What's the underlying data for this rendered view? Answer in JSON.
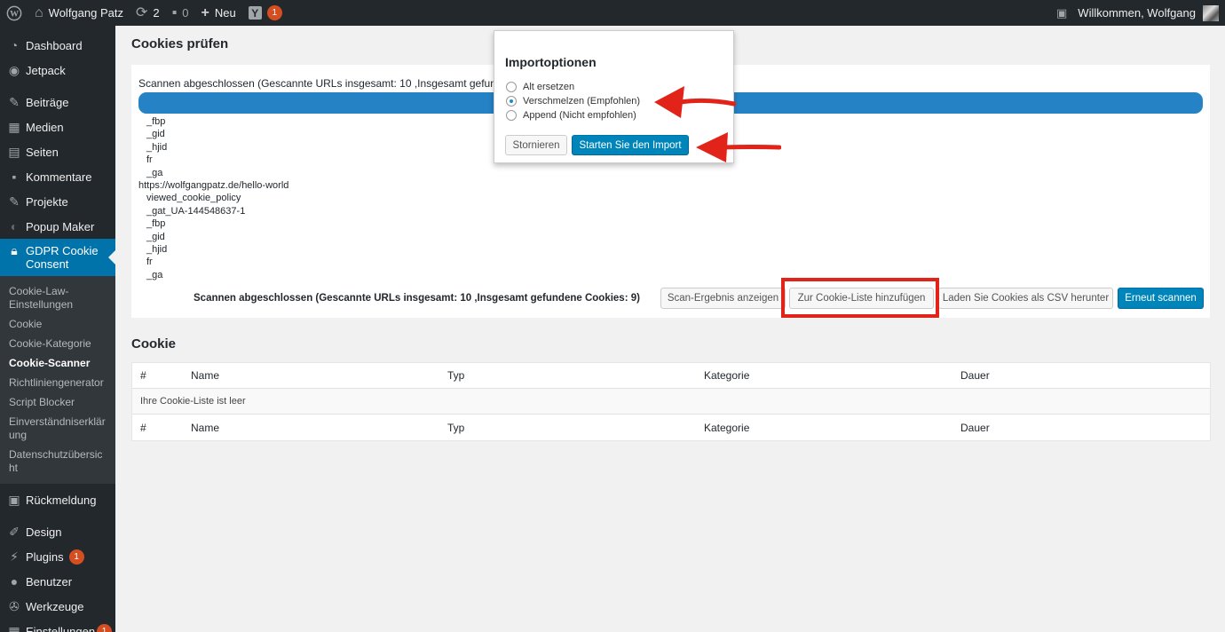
{
  "adminbar": {
    "site_name": "Wolfgang Patz",
    "updates_count": "2",
    "comments_count": "0",
    "new_label": "Neu",
    "yoast_letter": "Y",
    "yoast_badge": "1",
    "greeting": "Willkommen, Wolfgang"
  },
  "sidebar": {
    "dashboard": "Dashboard",
    "jetpack": "Jetpack",
    "beitraege": "Beiträge",
    "medien": "Medien",
    "seiten": "Seiten",
    "kommentare": "Kommentare",
    "projekte": "Projekte",
    "popup_maker": "Popup Maker",
    "gdpr_line1": "GDPR Cookie",
    "gdpr_line2": "Consent",
    "submenu": [
      "Cookie-Law-Einstellungen",
      "Cookie",
      "Cookie-Kategorie",
      "Cookie-Scanner",
      "Richtliniengenerator",
      "Script Blocker",
      "Einverständniserklärung",
      "Datenschutzübersicht"
    ],
    "rueckmeldung": "Rückmeldung",
    "design": "Design",
    "plugins": "Plugins",
    "plugins_badge": "1",
    "benutzer": "Benutzer",
    "werkzeuge": "Werkzeuge",
    "einstellungen": "Einstellungen",
    "einstellungen_badge": "1"
  },
  "main": {
    "page_title": "Cookies prüfen",
    "scan_status": "Scannen abgeschlossen (Gescannte URLs insgesamt: 10 ,Insgesamt gefundene Cookies: 9)",
    "scan_list": [
      {
        "text": "_fbp",
        "type": "cookie"
      },
      {
        "text": "_gid",
        "type": "cookie"
      },
      {
        "text": "_hjid",
        "type": "cookie"
      },
      {
        "text": "fr",
        "type": "cookie"
      },
      {
        "text": "_ga",
        "type": "cookie"
      },
      {
        "text": "https://wolfgangpatz.de/hello-world",
        "type": "url"
      },
      {
        "text": "viewed_cookie_policy",
        "type": "cookie"
      },
      {
        "text": "_gat_UA-144548637-1",
        "type": "cookie"
      },
      {
        "text": "_fbp",
        "type": "cookie"
      },
      {
        "text": "_gid",
        "type": "cookie"
      },
      {
        "text": "_hjid",
        "type": "cookie"
      },
      {
        "text": "fr",
        "type": "cookie"
      },
      {
        "text": "_ga",
        "type": "cookie"
      }
    ],
    "scan_summary": "Scannen abgeschlossen (Gescannte URLs insgesamt: 10 ,Insgesamt gefundene Cookies: 9)",
    "buttons": {
      "show_result": "Scan-Ergebnis anzeigen",
      "add_to_list": "Zur Cookie-Liste hinzufügen",
      "download_csv": "Laden Sie Cookies als CSV herunter",
      "rescan": "Erneut scannen"
    },
    "cookie_section_title": "Cookie",
    "table": {
      "headers": [
        "#",
        "Name",
        "Typ",
        "Kategorie",
        "Dauer"
      ],
      "empty_message": "Ihre Cookie-Liste ist leer"
    }
  },
  "modal": {
    "title": "Importoptionen",
    "options": [
      "Alt ersetzen",
      "Verschmelzen (Empfohlen)",
      "Append (Nicht empfohlen)"
    ],
    "selected": "Verschmelzen (Empfohlen)",
    "cancel": "Stornieren",
    "start": "Starten Sie den Import"
  },
  "colors": {
    "accent": "#0073aa",
    "primary_button": "#0085ba",
    "progress": "#2582c5",
    "annotation_red": "#e2231a",
    "adminbar": "#23282d"
  }
}
